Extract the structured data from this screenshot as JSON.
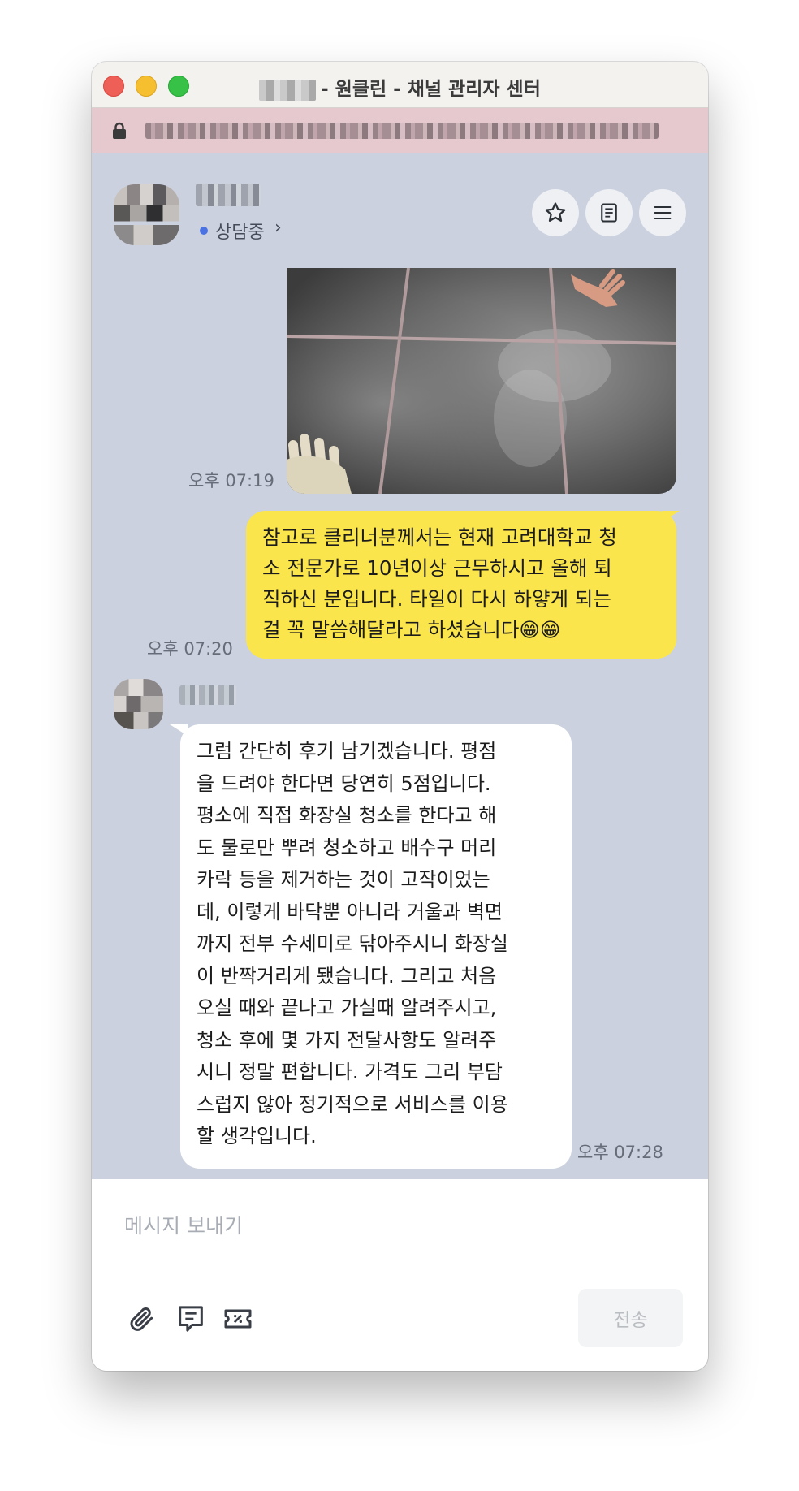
{
  "window": {
    "title": "- 원클린 - 채널 관리자 센터"
  },
  "header": {
    "status": "상담중",
    "status_chevron": "›",
    "status_color": "#4b72e2"
  },
  "messages": [
    {
      "type": "image",
      "sender": "me",
      "time": "오후 07:19",
      "image_content": "photo-of-cleaned-tile-floor"
    },
    {
      "type": "text",
      "sender": "me",
      "time": "오후 07:20",
      "lines": [
        "참고로 클리너분께서는 현재 고려대학교 청",
        "소 전문가로 10년이상 근무하시고 올해 퇴",
        "직하신 분입니다. 타일이 다시 하얗게 되는",
        "걸 꼭 말씀해달라고 하셨습니다😁😁"
      ]
    },
    {
      "type": "text",
      "sender": "customer",
      "time": "오후 07:28",
      "lines": [
        "그럼 간단히 후기 남기겠습니다. 평점",
        "을 드려야 한다면 당연히 5점입니다.",
        "평소에 직접 화장실 청소를 한다고 해",
        "도 물로만 뿌려 청소하고 배수구 머리",
        "카락 등을 제거하는 것이 고작이었는",
        "데, 이렇게 바닥뿐 아니라 거울과 벽면",
        "까지 전부 수세미로 닦아주시니 화장실",
        "이 반짝거리게 됐습니다. 그리고 처음",
        "오실 때와 끝나고 가실때 알려주시고,",
        "청소 후에 몇 가지 전달사항도 알려주",
        "시니 정말 편합니다. 가격도 그리 부담",
        "스럽지 않아 정기적으로 서비스를 이용",
        "할 생각입니다."
      ]
    }
  ],
  "composer": {
    "placeholder": "메시지 보내기",
    "send_label": "전송"
  },
  "colors": {
    "my_bubble": "#fbe54d",
    "other_bubble": "#ffffff",
    "chat_background": "#cbd1de",
    "url_bar": "#e6c9cf"
  }
}
